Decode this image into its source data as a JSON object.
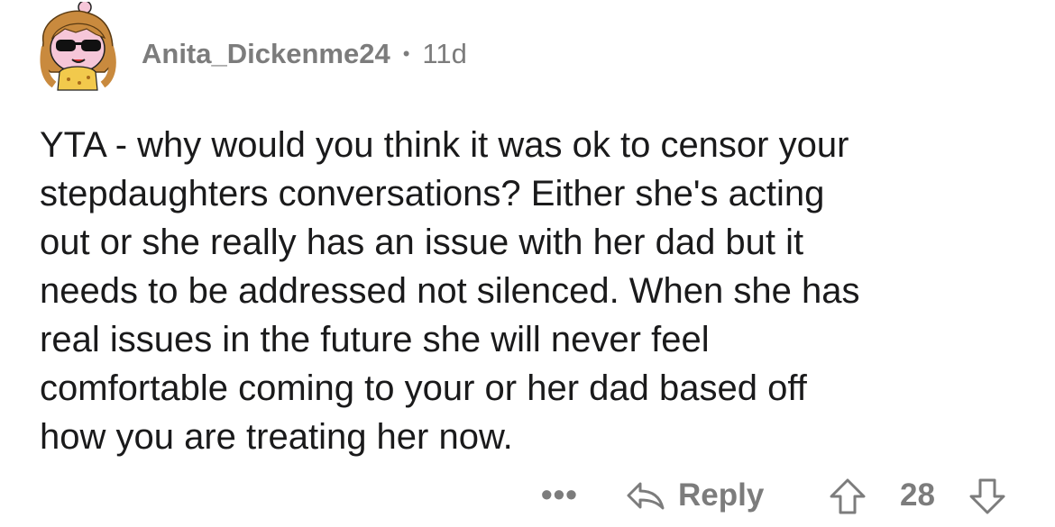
{
  "comment": {
    "username": "Anita_Dickenme24",
    "separator": "•",
    "age": "11d",
    "body_lines": [
      "YTA - why would you think it was ok to censor your",
      "stepdaughters conversations?  Either she's acting",
      "out or she really has an issue with her dad but it",
      "needs to be addressed not silenced.  When she has",
      "real issues in the future she will never feel",
      "comfortable coming to your or her dad based off",
      "how you are treating her now."
    ]
  },
  "actions": {
    "more_label": "•••",
    "reply_label": "Reply",
    "score": "28"
  },
  "icons": {
    "avatar": "snoo-avatar-with-sunglasses",
    "reply": "reply-arrow-icon",
    "upvote": "upvote-arrow-icon",
    "downvote": "downvote-arrow-icon"
  },
  "colors": {
    "meta_text": "#7c7c7c",
    "body_text": "#1a1a1b",
    "background": "#ffffff"
  }
}
